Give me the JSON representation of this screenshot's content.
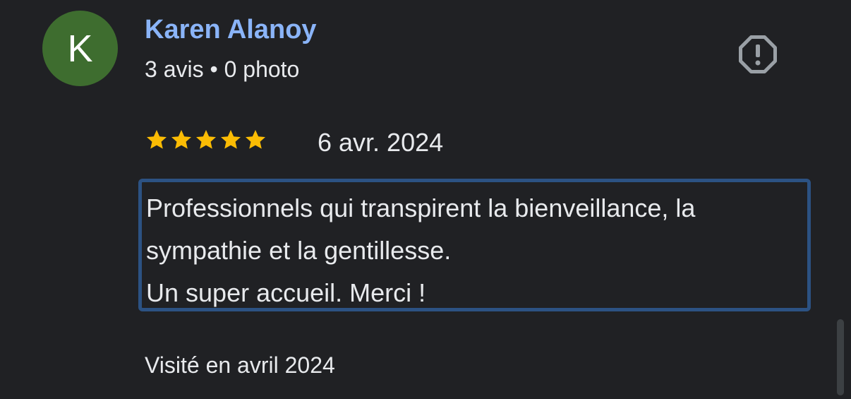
{
  "review": {
    "avatar_initial": "K",
    "author_name": "Karen Alanoy",
    "author_meta": "3 avis • 0 photo",
    "rating": 5,
    "rating_max": 5,
    "date": "6 avr. 2024",
    "text_lines": [
      "Professionnels qui transpirent la bienveillance, la",
      "sympathie et la gentillesse.",
      "Un super accueil. Merci !"
    ],
    "visit": "Visité en avril 2024",
    "report_icon": "report-flag-icon"
  },
  "colors": {
    "background": "#202124",
    "author_name": "#8ab4f8",
    "avatar_bg": "#3e6d2f",
    "star": "#fbbc04",
    "highlight_border": "#2c5283",
    "icon_gray": "#9aa0a6",
    "text": "#e8eaed"
  }
}
